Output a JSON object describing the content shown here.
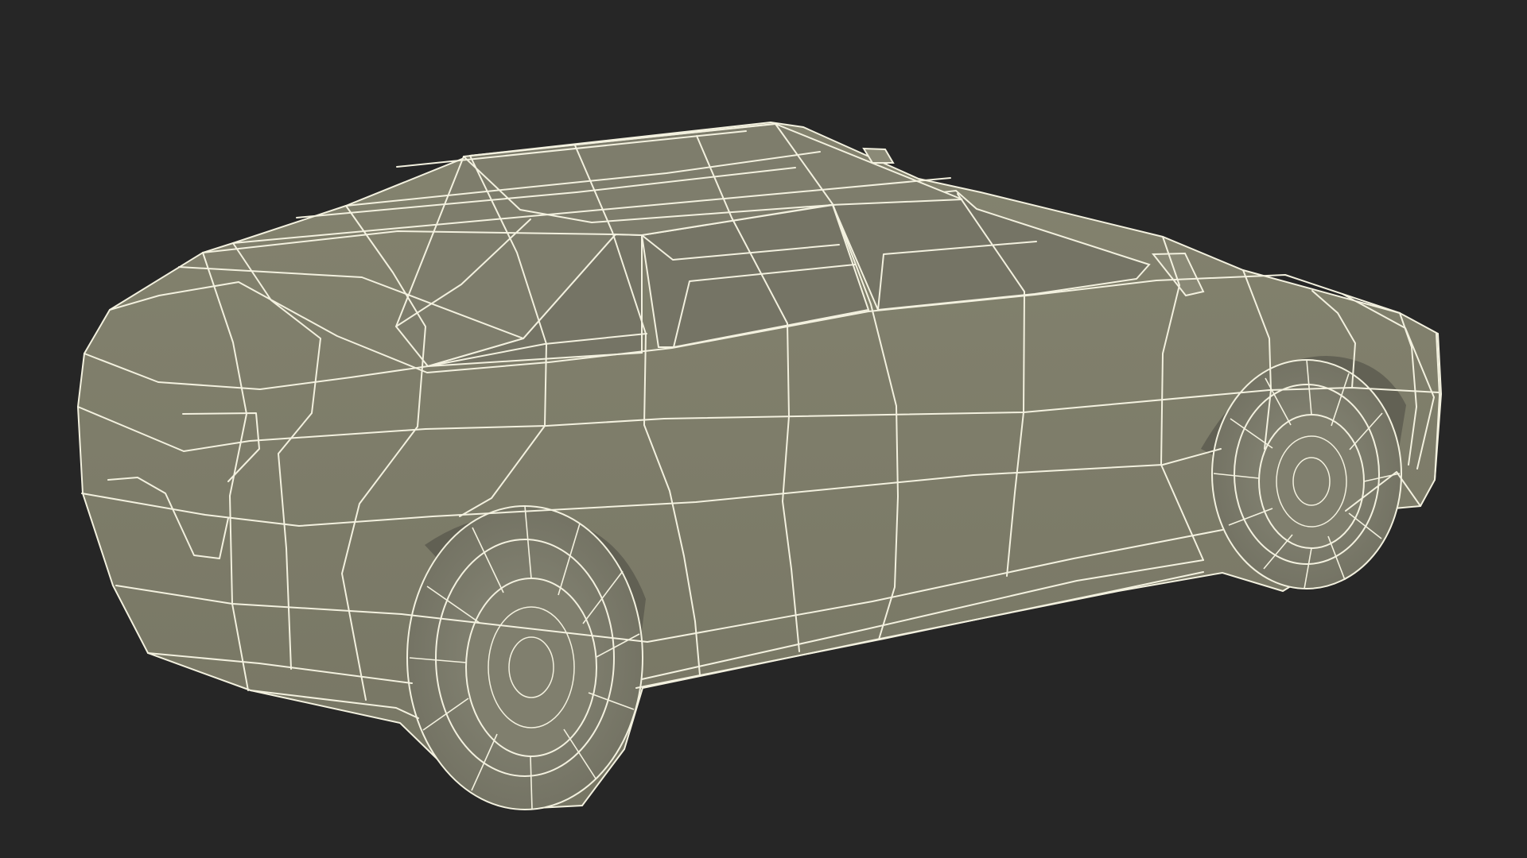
{
  "scene": {
    "subject": "wireframe-car-model",
    "colors": {
      "background": "#262626",
      "body": "#7c7b6c",
      "body_shadow": "#6b6a5c",
      "glass": "#737264",
      "wire": "#f3f1df",
      "dark_shadow": "#55544a"
    }
  }
}
